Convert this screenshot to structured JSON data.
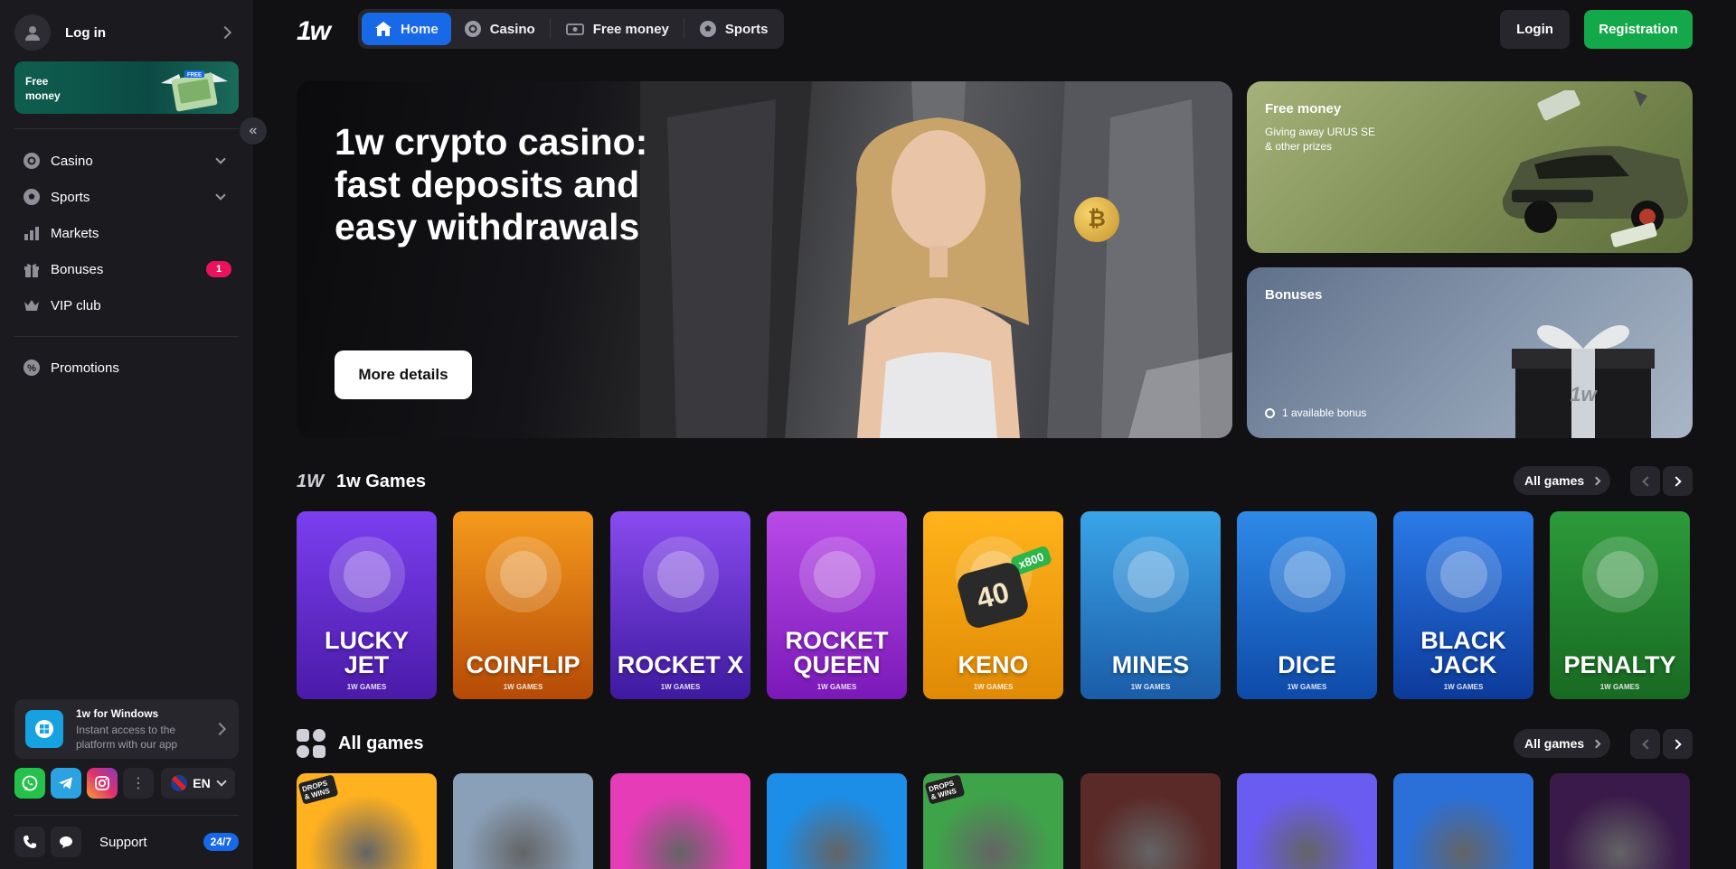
{
  "sidebar": {
    "login_label": "Log in",
    "free_money_banner": "Free money",
    "free_money_tag": "FREE",
    "nav": [
      {
        "label": "Casino",
        "icon": "casino-chip-icon"
      },
      {
        "label": "Sports",
        "icon": "soccer-ball-icon"
      },
      {
        "label": "Markets",
        "icon": "markets-icon"
      },
      {
        "label": "Bonuses",
        "icon": "gift-icon",
        "badge": "1"
      },
      {
        "label": "VIP club",
        "icon": "crown-icon"
      }
    ],
    "promotions_label": "Promotions",
    "windows_app": {
      "title": "1w for Windows",
      "subtitle": "Instant access to the platform with our app"
    },
    "language": "EN",
    "support_label": "Support",
    "support_badge": "24/7"
  },
  "header": {
    "logo": "1w",
    "tabs": [
      {
        "label": "Home",
        "active": true
      },
      {
        "label": "Casino"
      },
      {
        "label": "Free money"
      },
      {
        "label": "Sports"
      }
    ],
    "login_button": "Login",
    "register_button": "Registration"
  },
  "hero": {
    "title_line1": "1w crypto casino:",
    "title_line2": "fast deposits and",
    "title_line3": "easy withdrawals",
    "cta": "More details"
  },
  "promo_cards": {
    "free_money": {
      "title": "Free money",
      "subtitle": "Giving away URUS SE & other prizes"
    },
    "bonuses": {
      "title": "Bonuses",
      "count_text": "1 available bonus"
    }
  },
  "sections": {
    "games_title": "1w Games",
    "games_logo": "1W",
    "all_games_title": "All games",
    "all_games_button": "All games"
  },
  "games": [
    {
      "name_line1": "LUCKY",
      "name_line2": "JET",
      "studio": "1W GAMES",
      "color_top": "#7b3ff0",
      "color_bottom": "#4b1aa8"
    },
    {
      "name_line1": "COINFLIP",
      "name_line2": "",
      "studio": "1W GAMES",
      "color_top": "#f59a1c",
      "color_bottom": "#b54a06"
    },
    {
      "name_line1": "ROCKET X",
      "name_line2": "",
      "studio": "1W GAMES",
      "color_top": "#8a4bf0",
      "color_bottom": "#3e1aa0"
    },
    {
      "name_line1": "ROCKET",
      "name_line2": "QUEEN",
      "studio": "1W GAMES",
      "color_top": "#b94ae8",
      "color_bottom": "#7a19b8"
    },
    {
      "name_line1": "KENO",
      "name_line2": "",
      "studio": "1W GAMES",
      "color_top": "#ffb31a",
      "color_bottom": "#e08a06",
      "multiplier": "x800",
      "ball": "40"
    },
    {
      "name_line1": "MINES",
      "name_line2": "",
      "studio": "1W GAMES",
      "color_top": "#3aa4e8",
      "color_bottom": "#1a5ca8"
    },
    {
      "name_line1": "DICE",
      "name_line2": "",
      "studio": "1W GAMES",
      "color_top": "#2f8ae8",
      "color_bottom": "#0e4aa8"
    },
    {
      "name_line1": "BLACK",
      "name_line2": "JACK",
      "studio": "1W GAMES",
      "color_top": "#2b7be8",
      "color_bottom": "#0c3a9a"
    },
    {
      "name_line1": "PENALTY",
      "name_line2": "",
      "studio": "1W GAMES",
      "color_top": "#2c9a3a",
      "color_bottom": "#186a22"
    }
  ],
  "all_games_tiles": [
    {
      "bg": "#ffb11f",
      "label": "DROPS & WINS"
    },
    {
      "bg": "#8aa0b8"
    },
    {
      "bg": "#e63cb8"
    },
    {
      "bg": "#1c8ee8"
    },
    {
      "bg": "#3fa34a",
      "label": "DROPS & WINS"
    },
    {
      "bg": "#5a2a28"
    },
    {
      "bg": "#6a5cf0"
    },
    {
      "bg": "#2a70d8"
    },
    {
      "bg": "#3a1a4a"
    }
  ]
}
